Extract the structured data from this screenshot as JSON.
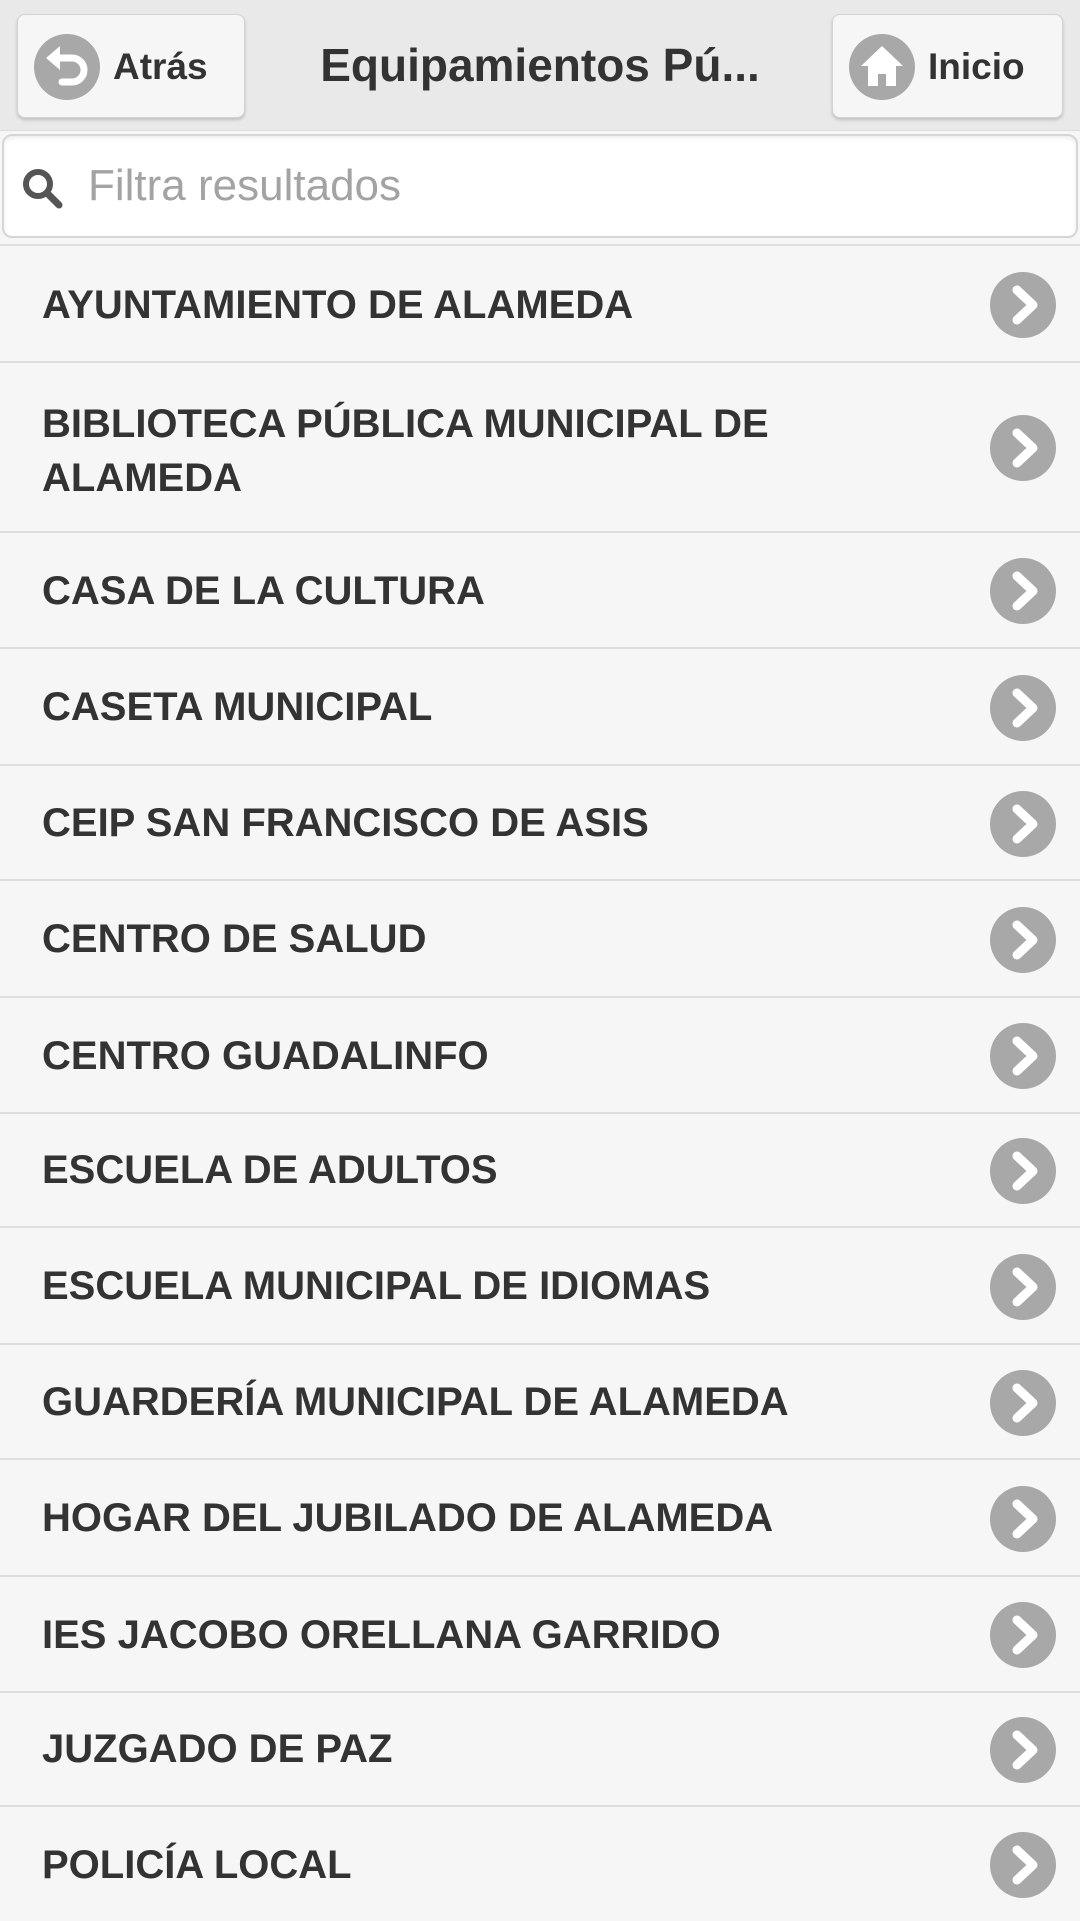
{
  "header": {
    "back_label": "Atrás",
    "title": "Equipamientos Pú...",
    "home_label": "Inicio"
  },
  "search": {
    "placeholder": "Filtra resultados",
    "value": ""
  },
  "list": {
    "items": [
      {
        "label": "AYUNTAMIENTO DE ALAMEDA"
      },
      {
        "label": "BIBLIOTECA PÚBLICA MUNICIPAL DE ALAMEDA"
      },
      {
        "label": "CASA DE LA CULTURA"
      },
      {
        "label": "CASETA MUNICIPAL"
      },
      {
        "label": "CEIP SAN FRANCISCO DE ASIS"
      },
      {
        "label": "CENTRO DE SALUD"
      },
      {
        "label": "CENTRO GUADALINFO"
      },
      {
        "label": "ESCUELA DE ADULTOS"
      },
      {
        "label": "ESCUELA MUNICIPAL DE IDIOMAS"
      },
      {
        "label": "GUARDERÍA MUNICIPAL DE ALAMEDA"
      },
      {
        "label": "HOGAR DEL JUBILADO DE ALAMEDA"
      },
      {
        "label": "IES JACOBO ORELLANA GARRIDO"
      },
      {
        "label": "JUZGADO DE PAZ"
      },
      {
        "label": "POLICÍA LOCAL"
      }
    ]
  },
  "icons": {
    "back": "back-arrow-icon",
    "home": "home-icon",
    "search": "search-icon",
    "item_arrow": "chevron-right-icon"
  },
  "colors": {
    "header_bg": "#e9e9e9",
    "icon_circle": "#a8a8a8",
    "text": "#333333",
    "list_bg": "#f6f6f6"
  }
}
